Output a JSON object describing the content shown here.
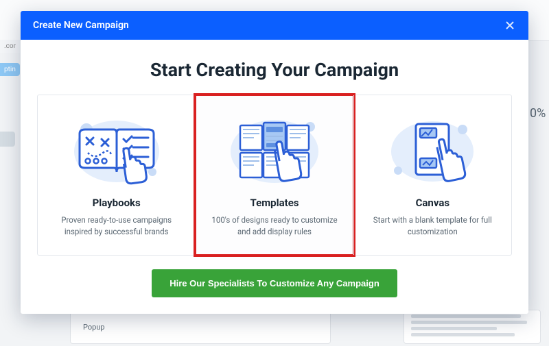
{
  "background": {
    "tag_text_1": ".cor",
    "tag_text_2": "ptin",
    "stat_text": "0%",
    "card_label": "Popup"
  },
  "modal": {
    "title": "Create New Campaign",
    "heading": "Start Creating Your Campaign",
    "options": [
      {
        "title": "Playbooks",
        "desc": "Proven ready-to-use campaigns inspired by successful brands"
      },
      {
        "title": "Templates",
        "desc": "100's of designs ready to customize and add display rules"
      },
      {
        "title": "Canvas",
        "desc": "Start with a blank template for full customization"
      }
    ],
    "cta_label": "Hire Our Specialists To Customize Any Campaign"
  }
}
